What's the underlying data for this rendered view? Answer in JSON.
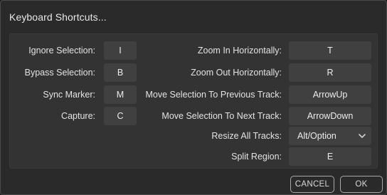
{
  "dialog": {
    "title": "Keyboard Shortcuts..."
  },
  "left_shortcuts": [
    {
      "label": "Ignore Selection:",
      "key": "I"
    },
    {
      "label": "Bypass Selection:",
      "key": "B"
    },
    {
      "label": "Sync Marker:",
      "key": "M"
    },
    {
      "label": "Capture:",
      "key": "C"
    }
  ],
  "right_shortcuts": [
    {
      "label": "Zoom In Horizontally:",
      "key": "T"
    },
    {
      "label": "Zoom Out Horizontally:",
      "key": "R"
    },
    {
      "label": "Move Selection To Previous Track:",
      "key": "ArrowUp"
    },
    {
      "label": "Move Selection To Next Track:",
      "key": "ArrowDown"
    },
    {
      "label": "Resize All Tracks:",
      "key": "Alt/Option",
      "control": "dropdown",
      "icon": "chevron-down-icon"
    },
    {
      "label": "Split Region:",
      "key": "E"
    }
  ],
  "footer": {
    "cancel_label": "CANCEL",
    "ok_label": "OK"
  },
  "colors": {
    "background": "#2a2a2a",
    "panel": "#333333",
    "key_field": "#404040",
    "button_border": "#a8a8a8",
    "text": "#e6e6e6"
  }
}
